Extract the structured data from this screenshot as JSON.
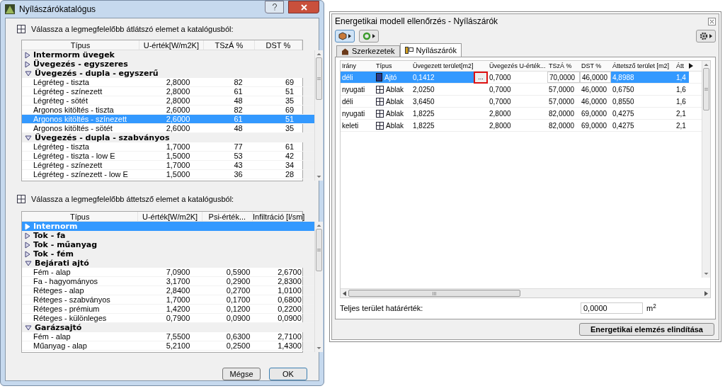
{
  "catalog_dialog": {
    "title": "Nyílászárókatalógus",
    "transparent_section": {
      "label": "Válassza a legmegfelelőbb átlátszó elemet a katalógusból:",
      "columns": [
        "Típus",
        "U-érték[W/m2K]",
        "TSzÁ %",
        "DST %"
      ],
      "groups": [
        {
          "name": "Intermorm üvegek",
          "expanded": false,
          "selected": false
        },
        {
          "name": "Üvegezés - egyszeres",
          "expanded": false,
          "selected": false
        },
        {
          "name": "Üvegezés - dupla - egyszerű",
          "expanded": true,
          "selected": false,
          "children": [
            {
              "cells": [
                "Légréteg - tiszta",
                "2,8000",
                "82",
                "69"
              ],
              "selected": false
            },
            {
              "cells": [
                "Légréteg - színezett",
                "2,8000",
                "61",
                "51"
              ],
              "selected": false
            },
            {
              "cells": [
                "Légréteg - sötét",
                "2,8000",
                "48",
                "35"
              ],
              "selected": false
            },
            {
              "cells": [
                "Argonos kitöltés - tiszta",
                "2,6000",
                "82",
                "69"
              ],
              "selected": false
            },
            {
              "cells": [
                "Argonos kitöltés - színezett",
                "2,6000",
                "61",
                "51"
              ],
              "selected": true
            },
            {
              "cells": [
                "Argonos kitöltés - sötét",
                "2,6000",
                "48",
                "35"
              ],
              "selected": false
            }
          ]
        },
        {
          "name": "Üvegezés - dupla - szabványos",
          "expanded": true,
          "selected": false,
          "children": [
            {
              "cells": [
                "Légréteg - tiszta",
                "1,7000",
                "77",
                "61"
              ],
              "selected": false
            },
            {
              "cells": [
                "Légréteg - tiszta - low E",
                "1,5000",
                "53",
                "42"
              ],
              "selected": false
            },
            {
              "cells": [
                "Légréteg - színezett",
                "1,7000",
                "43",
                "34"
              ],
              "selected": false
            },
            {
              "cells": [
                "Légréteg - színezett - low E",
                "1,5000",
                "36",
                "28"
              ],
              "selected": false
            }
          ]
        }
      ]
    },
    "opaque_section": {
      "label": "Válassza a legmegfelelőbb áttetsző elemet a katalógusból:",
      "columns": [
        "Típus",
        "U-érték[W/m2K]",
        "Psi-érték...",
        "Infiltráció [l/sm]"
      ],
      "groups": [
        {
          "name": "Internorm",
          "expanded": false,
          "selected": true
        },
        {
          "name": "Tok - fa",
          "expanded": false,
          "selected": false
        },
        {
          "name": "Tok - műanyag",
          "expanded": false,
          "selected": false
        },
        {
          "name": "Tok - fém",
          "expanded": false,
          "selected": false
        },
        {
          "name": "Bejárati ajtó",
          "expanded": true,
          "selected": false,
          "children": [
            {
              "cells": [
                "Fém - alap",
                "7,0900",
                "0,5900",
                "2,6700"
              ],
              "selected": false
            },
            {
              "cells": [
                "Fa - hagyományos",
                "3,1700",
                "0,2900",
                "2,8300"
              ],
              "selected": false
            },
            {
              "cells": [
                "Réteges - alap",
                "2,8400",
                "0,2700",
                "1,0100"
              ],
              "selected": false
            },
            {
              "cells": [
                "Réteges - szabványos",
                "1,7000",
                "0,1700",
                "0,6800"
              ],
              "selected": false
            },
            {
              "cells": [
                "Réteges - prémium",
                "1,4200",
                "0,1200",
                "0,2200"
              ],
              "selected": false
            },
            {
              "cells": [
                "Réteges - különleges",
                "0,7900",
                "0,0900",
                "0,0900"
              ],
              "selected": false
            }
          ]
        },
        {
          "name": "Garázsajtó",
          "expanded": true,
          "selected": false,
          "children": [
            {
              "cells": [
                "Fém - alap",
                "7,5500",
                "0,6300",
                "2,7100"
              ],
              "selected": false
            },
            {
              "cells": [
                "Műanyag - alap",
                "5,2100",
                "0,2500",
                "1,4300"
              ],
              "selected": false
            }
          ]
        }
      ]
    },
    "buttons": [
      "Mégse",
      "OK"
    ]
  },
  "check_window": {
    "title": "Energetikai modell ellenőrzés - Nyílászárók",
    "tabs": [
      {
        "label": "Szerkezetek",
        "selected": false
      },
      {
        "label": "Nyílászárók",
        "selected": true
      }
    ],
    "columns": [
      "Irány",
      "Típus",
      "Üvegezett terület[m2]",
      "Üvegezés U-érték...",
      "TSzÁ %",
      "DST %",
      "Áttetsző terület [m2]",
      "Átt"
    ],
    "browse_button": "...",
    "rows": [
      {
        "selected": true,
        "kind": "door",
        "cells": [
          "déli",
          "Ajtó",
          "0,1412",
          "0,7000",
          "70,0000",
          "46,0000",
          "4,8988",
          "1,4"
        ]
      },
      {
        "selected": false,
        "kind": "window",
        "cells": [
          "nyugati",
          "Ablak",
          "2,0250",
          "0,7000",
          "57,0000",
          "46,0000",
          "0,6750",
          "1,6"
        ]
      },
      {
        "selected": false,
        "kind": "window",
        "cells": [
          "déli",
          "Ablak",
          "3,6450",
          "0,7000",
          "57,0000",
          "46,0000",
          "0,8550",
          "1,6"
        ]
      },
      {
        "selected": false,
        "kind": "window",
        "cells": [
          "nyugati",
          "Ablak",
          "1,8225",
          "2,8000",
          "82,0000",
          "69,0000",
          "0,4275",
          "2,1"
        ]
      },
      {
        "selected": false,
        "kind": "window",
        "cells": [
          "keleti",
          "Ablak",
          "1,8225",
          "2,8000",
          "82,0000",
          "69,0000",
          "0,4275",
          "2,1"
        ]
      }
    ],
    "limit_label": "Teljes terület határérték:",
    "limit_value": "0,0000",
    "limit_unit": "m$^{2}$",
    "run_button": "Energetikai elemzés elindítása"
  }
}
